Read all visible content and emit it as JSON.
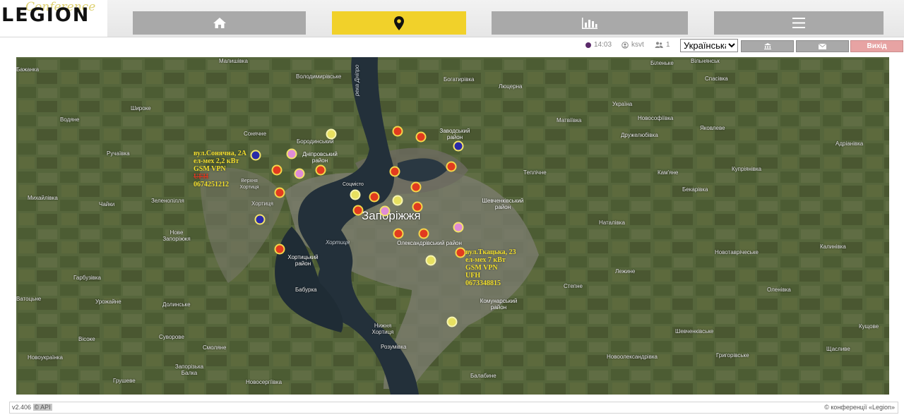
{
  "logo": {
    "main": "LEGION",
    "script": "Conference"
  },
  "nav": [
    {
      "name": "home-icon",
      "active": false
    },
    {
      "name": "map-pin-icon",
      "active": true
    },
    {
      "name": "bar-chart-icon",
      "active": false
    },
    {
      "name": "menu-icon",
      "active": false
    }
  ],
  "status": {
    "time": "14:03",
    "user": "ksvt",
    "online_count": "1"
  },
  "language": {
    "selected": "Українська"
  },
  "buttons": {
    "exit_label": "Вихід"
  },
  "map": {
    "city": "Запоріжжя",
    "river_label": "река Дніпро",
    "places": [
      "Малишівка",
      "Володимирівське",
      "Богатирівка",
      "Люцерна",
      "Біленьке",
      "Вільнянськ",
      "Спасівка",
      "Бажанка",
      "Широке",
      "Водяне",
      "Сонячне",
      "Бородинський",
      "Ручаївка",
      "Михайлівка",
      "Чайки",
      "Зеленопілля",
      "Нове Запоріжжя",
      "Хортиця",
      "Верхня Хортиця",
      "Матвіївка",
      "Україна",
      "Новософіївка",
      "Дружелюбівка",
      "Яковлеве",
      "Адріанівка",
      "Кам'яне",
      "Купріянівка",
      "Бекарівка",
      "Теплічне",
      "Наталівка",
      "Новотаврічеське",
      "Калинівка",
      "Лежине",
      "Степне",
      "Оленівка",
      "Гарбузівка",
      "Урожайне",
      "Долинське",
      "Бабурка",
      "Вісоке",
      "Новоукраїнка",
      "Суворове",
      "Смоляне",
      "Запорізька Балка",
      "Грушеве",
      "Розумівка",
      "Новосергіївка",
      "Балабине",
      "Новоолександрівка",
      "Шевченківське",
      "Григорівське",
      "Щасливе",
      "Кущове",
      "Соцмісто",
      "Нижня Хортиця",
      "Ватоцьне"
    ],
    "districts": [
      "Дніпровський район",
      "Заводський район",
      "Шевченківський район",
      "Олександрівський район",
      "Хортицький район",
      "Комунарський район"
    ],
    "water_label": "Хортиця",
    "callouts": [
      {
        "lines": [
          "вул.Сонячна, 2А",
          "ел-мех 2,2 кВт",
          "GSM VPN"
        ],
        "strike": "UFH",
        "phone": "0674251212"
      },
      {
        "lines": [
          "вул.Ткацька, 23",
          "ел-мех 7 кВт",
          "GSM VPN",
          "UFH"
        ],
        "strike": "",
        "phone": "0673348815"
      }
    ]
  },
  "footer": {
    "version": "v2.406",
    "api": "© API",
    "copyright": "© конференції «Legion»"
  },
  "colors": {
    "accent": "#f1d12a",
    "nav_inactive": "#a9a9a9",
    "exit_button": "#e7a3a3",
    "marker_red": "#e23b1f",
    "marker_yellow": "#e7e060",
    "marker_blue": "#2a2aa8",
    "marker_pink": "#e08cd6"
  }
}
